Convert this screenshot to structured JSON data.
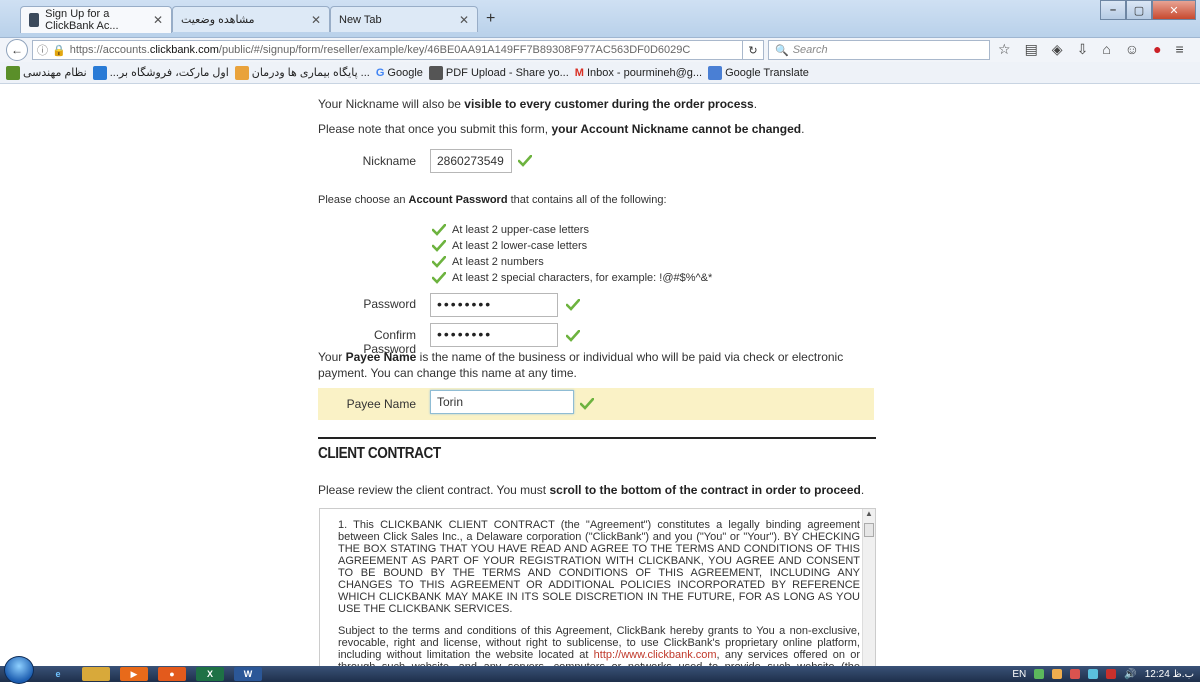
{
  "browser": {
    "tabs": [
      {
        "label": "Sign Up for a ClickBank Ac...",
        "active": true
      },
      {
        "label": "مشاهده وضعیت",
        "active": false
      },
      {
        "label": "New Tab",
        "active": false
      }
    ],
    "new_tab_label": "+",
    "url_prefix": "https://accounts.",
    "url_domain": "clickbank.com",
    "url_rest": "/public/#/signup/form/reseller/example/key/46BE0AA91A149FF7B89308F977AC563DF0D6029C",
    "search_placeholder": "Search",
    "bookmarks": [
      {
        "label": "نظام مهندسی",
        "icon_color": "#5a8f29"
      },
      {
        "label": "...اول مارکت، فروشگاه بر",
        "icon_color": "#2a7bd6"
      },
      {
        "label": "پایگاه بیماری ها ودرمان ...",
        "icon_color": "#e9a23b"
      },
      {
        "label": "Google",
        "icon_color": "#4285f4"
      },
      {
        "label": "PDF Upload - Share yo...",
        "icon_color": "#555555"
      },
      {
        "label": "Inbox - pourmineh@g...",
        "icon_color": "#d93025"
      },
      {
        "label": "Google Translate",
        "icon_color": "#4a7fd4"
      }
    ]
  },
  "form": {
    "intro_prefix": "Your Nickname will also be ",
    "intro_bold": "visible to every customer during the order process",
    "intro_suffix": ".",
    "note_prefix": "Please note that once you submit this form, ",
    "note_bold": "your Account Nickname cannot be changed",
    "note_suffix": ".",
    "nickname_label": "Nickname",
    "nickname_value": "2860273549",
    "password_intro_prefix": "Please choose an ",
    "password_intro_bold": "Account Password",
    "password_intro_suffix": " that contains all of the following:",
    "rules": [
      "At least 2 upper-case letters",
      "At least 2 lower-case letters",
      "At least 2 numbers",
      "At least 2 special characters, for example: !@#$%^&*"
    ],
    "password_label": "Password",
    "password_value": "••••••••",
    "confirm_label": "Confirm Password",
    "confirm_value": "••••••••",
    "payee_intro_prefix": "Your ",
    "payee_intro_bold": "Payee Name",
    "payee_intro_suffix": " is the name of the business or individual who will be paid via check or electronic payment. You can change this name at any time.",
    "payee_label": "Payee Name",
    "payee_value": "Torin"
  },
  "contract": {
    "title": "CLIENT CONTRACT",
    "review_prefix": "Please review the client contract. You must ",
    "review_bold": "scroll to the bottom of the contract in order to proceed",
    "review_suffix": ".",
    "para1": "1. This CLICKBANK CLIENT CONTRACT (the \"Agreement\") constitutes a legally binding agreement between Click Sales Inc., a Delaware corporation (\"ClickBank\") and you (\"You\" or \"Your\"). BY CHECKING THE BOX STATING THAT YOU HAVE READ AND AGREE TO THE TERMS AND CONDITIONS OF THIS AGREEMENT AS PART OF YOUR REGISTRATION WITH CLICKBANK, YOU AGREE AND CONSENT TO BE BOUND BY THE TERMS AND CONDITIONS OF THIS AGREEMENT, INCLUDING ANY CHANGES TO THIS AGREEMENT OR ADDITIONAL POLICIES INCORPORATED BY REFERENCE WHICH CLICKBANK MAY MAKE IN ITS SOLE DISCRETION IN THE FUTURE, FOR AS LONG AS YOU USE THE CLICKBANK SERVICES.",
    "para2_a": "Subject to the terms and conditions of this Agreement, ClickBank hereby grants to You a non-exclusive, revocable, right and license, without right to sublicense, to use ClickBank's proprietary online platform, including without limitation the website located at ",
    "para2_link": "http://www.clickbank.com",
    "para2_b": ", any services offered on or through such website, and any servers, computers or networks used to provide such website (the \"ClickBank Services\") for the purposes set forth in this Agreement. In the event You transfer Your account or ownership of any Product, as defined below, You shall"
  },
  "taskbar": {
    "lang": "EN",
    "clock": "12:24 ب.ظ"
  },
  "colors": {
    "check_green": "#6db33f",
    "payee_highlight": "#faf2c6",
    "link_red": "#c0392b"
  }
}
